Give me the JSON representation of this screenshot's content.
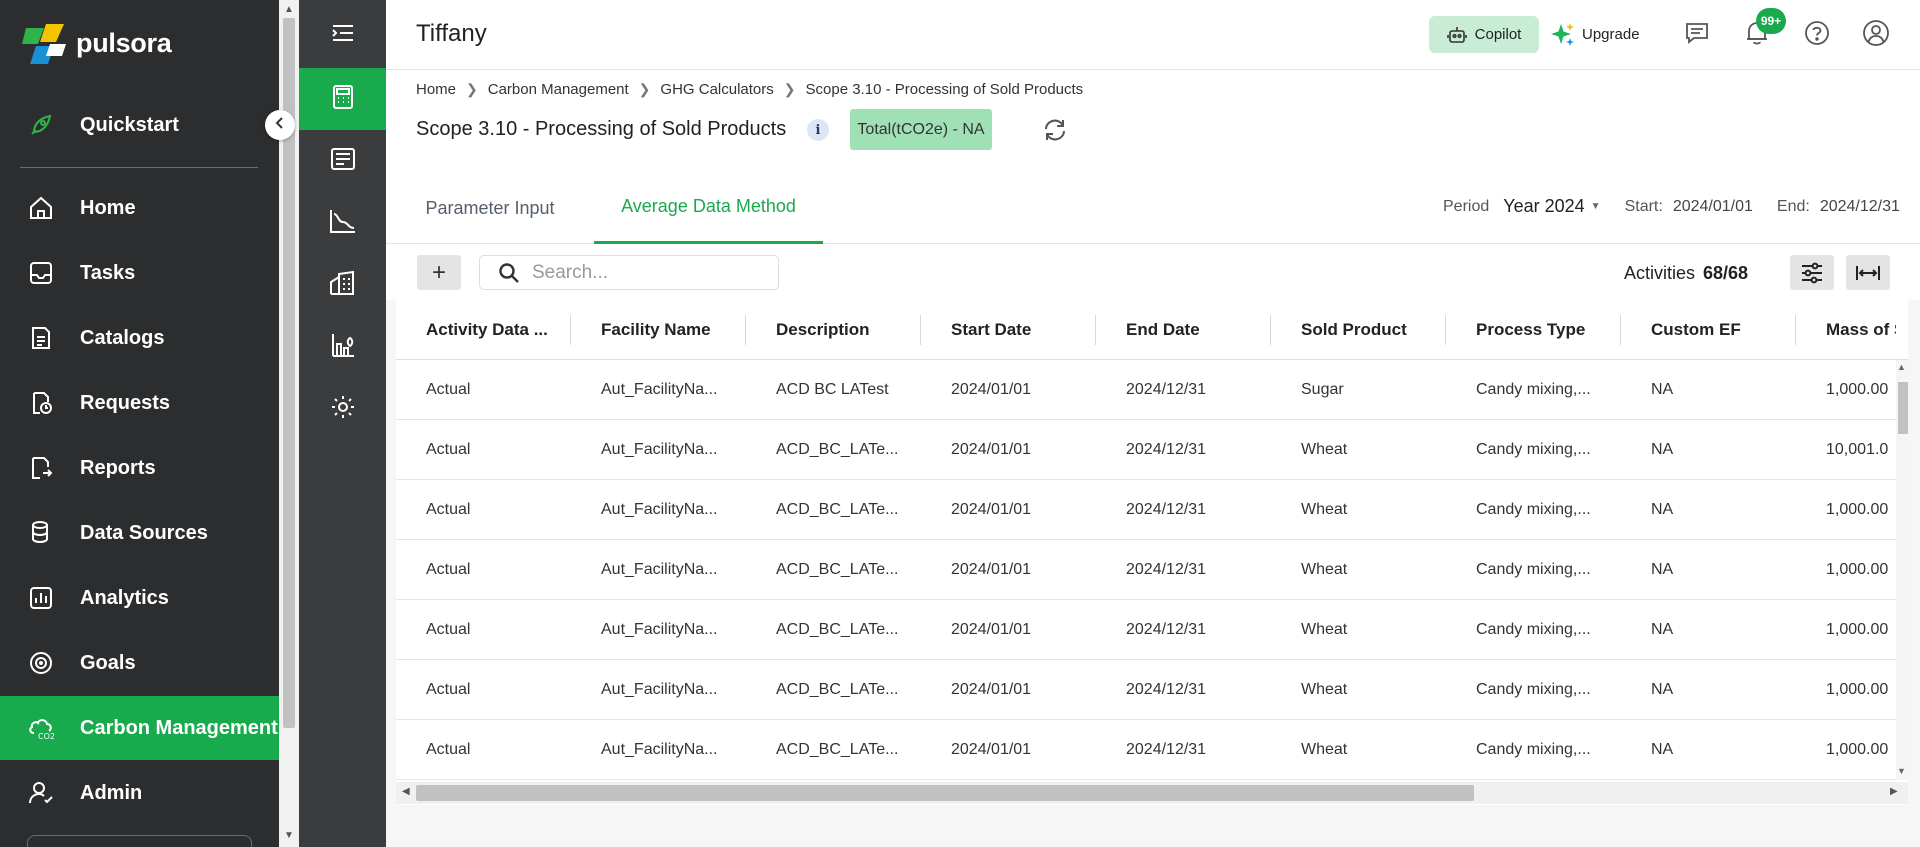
{
  "brand": {
    "name": "pulsora"
  },
  "leftnav": {
    "items": [
      {
        "label": "Quickstart",
        "icon": "rocket-icon"
      },
      {
        "label": "Home",
        "icon": "home-icon"
      },
      {
        "label": "Tasks",
        "icon": "inbox-icon"
      },
      {
        "label": "Catalogs",
        "icon": "catalog-icon"
      },
      {
        "label": "Requests",
        "icon": "requests-icon"
      },
      {
        "label": "Reports",
        "icon": "reports-icon"
      },
      {
        "label": "Data Sources",
        "icon": "database-icon"
      },
      {
        "label": "Analytics",
        "icon": "analytics-icon"
      },
      {
        "label": "Goals",
        "icon": "goals-icon"
      },
      {
        "label": "Carbon Management",
        "icon": "carbon-cloud-icon",
        "active": true
      },
      {
        "label": "Admin",
        "icon": "admin-user-icon"
      }
    ]
  },
  "rail": {
    "items": [
      {
        "icon": "menu-collapse-icon"
      },
      {
        "icon": "calculator-icon",
        "active": true
      },
      {
        "icon": "ledger-icon"
      },
      {
        "icon": "line-chart-icon"
      },
      {
        "icon": "building-icon"
      },
      {
        "icon": "plant-icon"
      },
      {
        "icon": "settings-icon"
      }
    ]
  },
  "header": {
    "title": "Tiffany",
    "copilot_label": "Copilot",
    "upgrade_label": "Upgrade",
    "notification_badge": "99+"
  },
  "breadcrumb": [
    "Home",
    "Carbon Management",
    "GHG Calculators",
    "Scope 3.10 - Processing of Sold Products"
  ],
  "page": {
    "title": "Scope 3.10 - Processing of Sold Products",
    "info_glyph": "i",
    "total_label": "Total(tCO2e) - NA"
  },
  "tabs": [
    {
      "label": "Parameter Input",
      "active": false
    },
    {
      "label": "Average Data Method",
      "active": true
    }
  ],
  "period": {
    "label": "Period",
    "value": "Year 2024",
    "start_label": "Start:",
    "start": "2024/01/01",
    "end_label": "End:",
    "end": "2024/12/31"
  },
  "toolbar": {
    "add_label": "+",
    "search_placeholder": "Search...",
    "activities_label": "Activities",
    "activities_count": "68/68"
  },
  "table": {
    "columns": [
      "Activity Data ...",
      "Facility Name",
      "Description",
      "Start Date",
      "End Date",
      "Sold Product",
      "Process Type",
      "Custom EF",
      "Mass of So"
    ],
    "rows": [
      [
        "Actual",
        "Aut_FacilityNa...",
        "ACD BC LATest",
        "2024/01/01",
        "2024/12/31",
        "Sugar",
        "Candy mixing,...",
        "NA",
        "1,000.00"
      ],
      [
        "Actual",
        "Aut_FacilityNa...",
        "ACD_BC_LATe...",
        "2024/01/01",
        "2024/12/31",
        "Wheat",
        "Candy mixing,...",
        "NA",
        "10,001.0"
      ],
      [
        "Actual",
        "Aut_FacilityNa...",
        "ACD_BC_LATe...",
        "2024/01/01",
        "2024/12/31",
        "Wheat",
        "Candy mixing,...",
        "NA",
        "1,000.00"
      ],
      [
        "Actual",
        "Aut_FacilityNa...",
        "ACD_BC_LATe...",
        "2024/01/01",
        "2024/12/31",
        "Wheat",
        "Candy mixing,...",
        "NA",
        "1,000.00"
      ],
      [
        "Actual",
        "Aut_FacilityNa...",
        "ACD_BC_LATe...",
        "2024/01/01",
        "2024/12/31",
        "Wheat",
        "Candy mixing,...",
        "NA",
        "1,000.00"
      ],
      [
        "Actual",
        "Aut_FacilityNa...",
        "ACD_BC_LATe...",
        "2024/01/01",
        "2024/12/31",
        "Wheat",
        "Candy mixing,...",
        "NA",
        "1,000.00"
      ],
      [
        "Actual",
        "Aut_FacilityNa...",
        "ACD_BC_LATe...",
        "2024/01/01",
        "2024/12/31",
        "Wheat",
        "Candy mixing,...",
        "NA",
        "1,000.00"
      ]
    ]
  },
  "colors": {
    "accent_green": "#1aaa4e",
    "nav_bg": "#2b2d2e",
    "rail_bg": "#3a3c3e",
    "copilot_bg": "#c9ecd6",
    "total_pill_bg": "#9fe0b4"
  }
}
